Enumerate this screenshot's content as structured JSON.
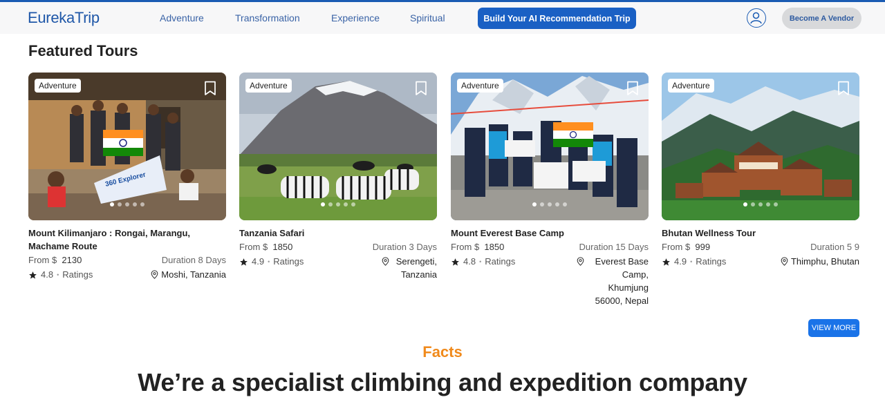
{
  "header": {
    "logo": "EurekaTrip",
    "nav": [
      "Adventure",
      "Transformation",
      "Experience",
      "Spiritual"
    ],
    "cta": "Build Your AI Recommendation Trip",
    "vendor": "Become A Vendor"
  },
  "featured": {
    "title": "Featured Tours",
    "tours": [
      {
        "tag": "Adventure",
        "title": "Mount Kilimanjaro : Rongai, Marangu, Machame Route",
        "price_label": "From $",
        "price": "2130",
        "duration": "Duration 8 Days",
        "rating": "4.8",
        "ratings_label": "Ratings",
        "location": "Moshi, Tanzania"
      },
      {
        "tag": "Adventure",
        "title": "Tanzania Safari",
        "price_label": "From $",
        "price": "1850",
        "duration": "Duration 3 Days",
        "rating": "4.9",
        "ratings_label": "Ratings",
        "location": "Serengeti, Tanzania"
      },
      {
        "tag": "Adventure",
        "title": "Mount Everest Base Camp",
        "price_label": "From $",
        "price": "1850",
        "duration": "Duration 15 Days",
        "rating": "4.8",
        "ratings_label": "Ratings",
        "location": "Everest Base Camp, Khumjung 56000, Nepal"
      },
      {
        "tag": "Adventure",
        "title": "Bhutan Wellness Tour",
        "price_label": "From $",
        "price": "999",
        "duration": "Duration 5 9",
        "rating": "4.9",
        "ratings_label": "Ratings",
        "location": "Thimphu, Bhutan"
      }
    ],
    "view_more": "VIEW MORE"
  },
  "facts": {
    "label": "Facts",
    "headline": "We’re a specialist climbing and expedition company"
  },
  "colors": {
    "brand": "#1f57a8",
    "cta": "#1a60c4",
    "accent": "#f08a1c"
  }
}
